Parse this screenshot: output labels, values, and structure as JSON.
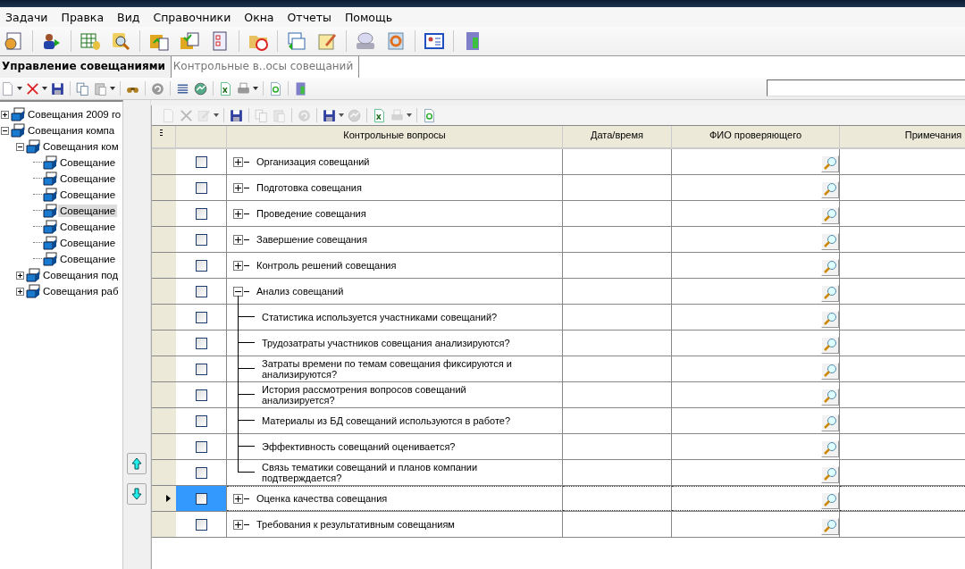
{
  "menu": [
    "Задачи",
    "Правка",
    "Вид",
    "Справочники",
    "Окна",
    "Отчеты",
    "Помощь"
  ],
  "tabs": [
    {
      "label": "Управление совещаниями",
      "selected": true
    },
    {
      "label": "Контрольные в..осы совещаний",
      "selected": false
    }
  ],
  "tree": [
    {
      "label": "Совещания 2009 го",
      "expanded": false,
      "selected": false
    },
    {
      "label": "Совещания компа",
      "expanded": true,
      "selected": false,
      "children": [
        {
          "label": "Совещания ком",
          "expanded": true,
          "selected": false,
          "children": [
            {
              "label": "Совещание",
              "selected": false
            },
            {
              "label": "Совещание",
              "selected": false
            },
            {
              "label": "Совещание",
              "selected": false
            },
            {
              "label": "Совещание",
              "selected": true
            },
            {
              "label": "Совещание",
              "selected": false
            },
            {
              "label": "Совещание",
              "selected": false
            },
            {
              "label": "Совещание",
              "selected": false
            }
          ]
        },
        {
          "label": "Совещания под",
          "expanded": false,
          "selected": false
        },
        {
          "label": "Совещания раб",
          "expanded": false,
          "selected": false
        }
      ]
    }
  ],
  "grid_toolbar": [
    {
      "disabled": true
    },
    {
      "disabled": true
    },
    {
      "disabled": true
    },
    {
      "disabled": false
    },
    {
      "disabled": true
    },
    {
      "disabled": true
    },
    {
      "disabled": true
    },
    {
      "disabled": false
    },
    {
      "disabled": true
    },
    {
      "disabled": false
    },
    {
      "disabled": true
    },
    {
      "disabled": false
    }
  ],
  "grid": {
    "columns": [
      "Контрольные вопросы",
      "Дата/время",
      "ФИО проверяющего",
      "Примечания"
    ],
    "rows": [
      {
        "text": "Организация совещаний",
        "expanded": false,
        "checked": false,
        "selected": false
      },
      {
        "text": "Подготовка совещания",
        "expanded": false,
        "checked": false,
        "selected": false
      },
      {
        "text": "Проведение совещания",
        "expanded": false,
        "checked": false,
        "selected": false
      },
      {
        "text": "Завершение совещания",
        "expanded": false,
        "checked": false,
        "selected": false
      },
      {
        "text": "Контроль решений совещания",
        "expanded": false,
        "checked": false,
        "selected": false
      },
      {
        "text": "Анализ совещаний",
        "expanded": true,
        "checked": false,
        "selected": false,
        "children": [
          {
            "text": "Статистика используется участниками совещаний?",
            "checked": false,
            "selected": false
          },
          {
            "text": "Трудозатраты участников совещания анализируются?",
            "checked": false,
            "selected": false
          },
          {
            "text": "Затраты времени по темам совещания фиксируются и анализируются?",
            "checked": false,
            "selected": false
          },
          {
            "text": "История рассмотрения вопросов совещаний анализируется?",
            "checked": false,
            "selected": false
          },
          {
            "text": "Материалы из БД совещаний используются в работе?",
            "checked": false,
            "selected": false
          },
          {
            "text": "Эффективность совещаний оценивается?",
            "checked": false,
            "selected": false
          },
          {
            "text": "Связь тематики совещаний и планов компании подтверждается?",
            "checked": false,
            "selected": false
          }
        ]
      },
      {
        "text": "Оценка качества совещания",
        "expanded": false,
        "checked": false,
        "selected": true
      },
      {
        "text": "Требования к результативным совещаниям",
        "expanded": false,
        "checked": false,
        "selected": false
      }
    ]
  }
}
